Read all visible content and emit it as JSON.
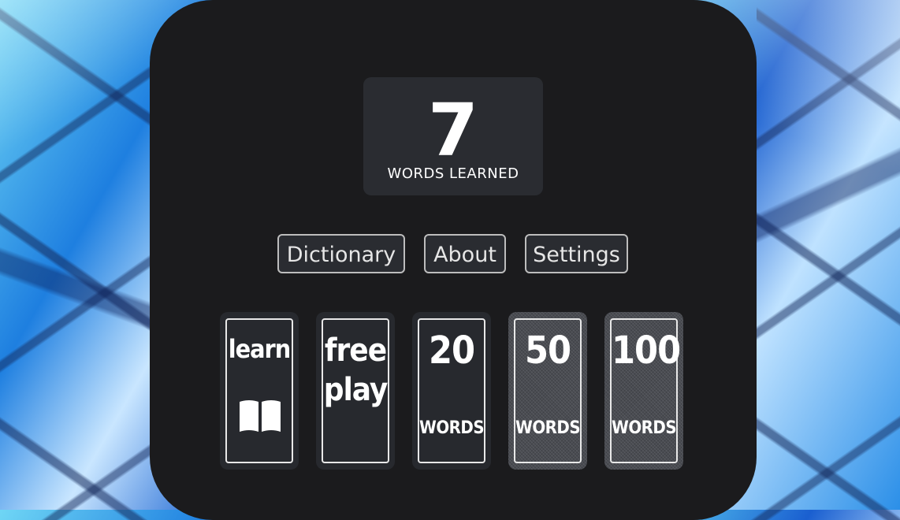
{
  "counter": {
    "value": "7",
    "label": "WORDS LEARNED"
  },
  "nav": {
    "dictionary": "Dictionary",
    "about": "About",
    "settings": "Settings"
  },
  "modes": [
    {
      "title": "learn",
      "icon": "book-icon"
    },
    {
      "title_line1": "free",
      "title_line2": "play"
    },
    {
      "number": "20",
      "unit": "WORDS"
    },
    {
      "number": "50",
      "unit": "WORDS"
    },
    {
      "number": "100",
      "unit": "WORDS"
    }
  ],
  "colors": {
    "panel": "#1b1b1d",
    "card": "#27292e",
    "border": "#e8e8e8"
  }
}
